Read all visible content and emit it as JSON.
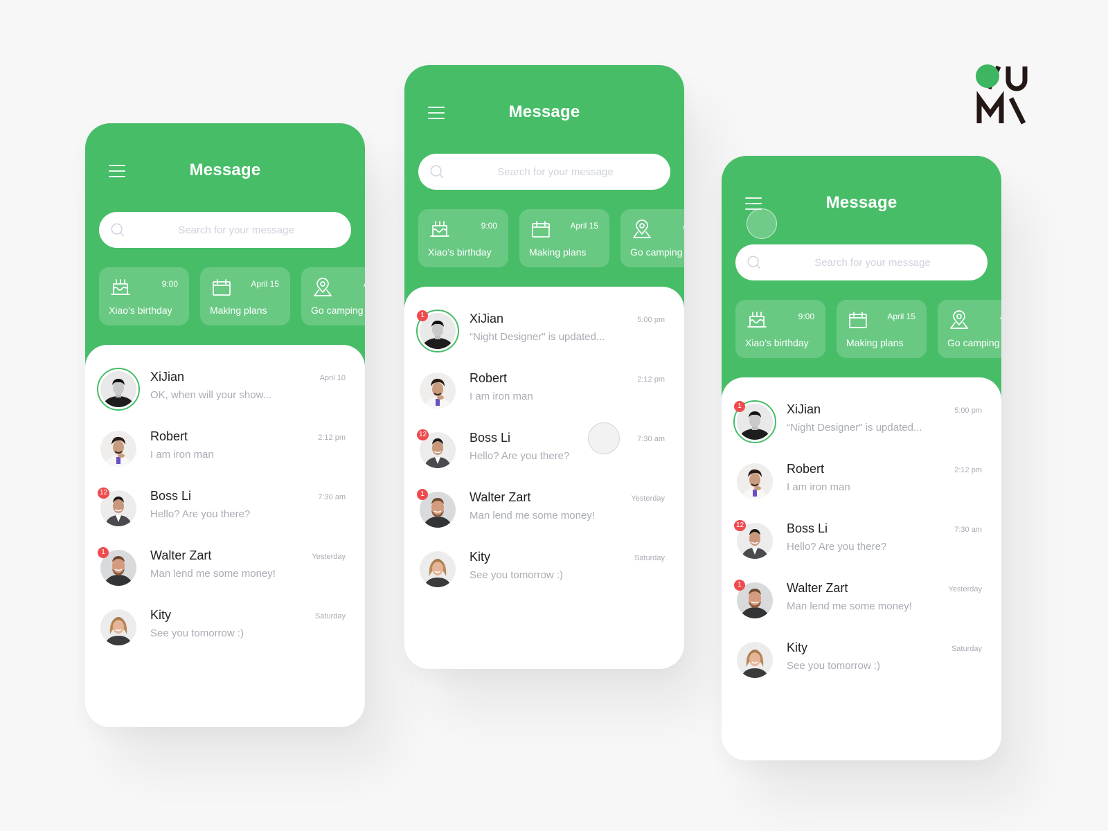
{
  "brand": {
    "logo_line1": "YU",
    "logo_line2": "MW",
    "accent_color": "#48bd68",
    "badge_color": "#ee4b4f"
  },
  "screens": [
    {
      "title": "Message",
      "search": {
        "placeholder": "Search for your message",
        "value": ""
      },
      "events": [
        {
          "icon": "birthday-cake-icon",
          "time": "9:00",
          "label": "Xiao’s birthday"
        },
        {
          "icon": "calendar-icon",
          "time": "April 15",
          "label": "Making plans"
        },
        {
          "icon": "location-pin-icon",
          "time": "April",
          "label": "Go camping"
        }
      ],
      "chats": [
        {
          "name": "XiJian",
          "preview": "OK,  when will your show...",
          "time": "April 10",
          "badge": "",
          "highlighted": true
        },
        {
          "name": "Robert",
          "preview": "I am iron man",
          "time": "2:12 pm",
          "badge": ""
        },
        {
          "name": "Boss Li",
          "preview": "Hello? Are you there?",
          "time": "7:30 am",
          "badge": "12"
        },
        {
          "name": "Walter Zart",
          "preview": "Man lend me some money!",
          "time": "Yesterday",
          "badge": "1"
        },
        {
          "name": "Kity",
          "preview": "See you tomorrow :)",
          "time": "Saturday",
          "badge": ""
        }
      ]
    },
    {
      "title": "Message",
      "search": {
        "placeholder": "Search for your message",
        "value": ""
      },
      "events": [
        {
          "icon": "birthday-cake-icon",
          "time": "9:00",
          "label": "Xiao’s birthday"
        },
        {
          "icon": "calendar-icon",
          "time": "April 15",
          "label": "Making plans"
        },
        {
          "icon": "location-pin-icon",
          "time": "April",
          "label": "Go camping"
        }
      ],
      "chats": [
        {
          "name": "XiJian",
          "preview": "“Night Designer\" is updated...",
          "time": "5:00 pm",
          "badge": "1",
          "highlighted": true
        },
        {
          "name": "Robert",
          "preview": "I am iron man",
          "time": "2:12 pm",
          "badge": ""
        },
        {
          "name": "Boss Li",
          "preview": "Hello? Are you there?",
          "time": "7:30 am",
          "badge": "12"
        },
        {
          "name": "Walter Zart",
          "preview": "Man lend me some money!",
          "time": "Yesterday",
          "badge": "1"
        },
        {
          "name": "Kity",
          "preview": "See you tomorrow :)",
          "time": "Saturday",
          "badge": ""
        }
      ]
    },
    {
      "title": "Message",
      "search": {
        "placeholder": "Search for your message",
        "value": ""
      },
      "events": [
        {
          "icon": "birthday-cake-icon",
          "time": "9:00",
          "label": "Xiao’s birthday"
        },
        {
          "icon": "calendar-icon",
          "time": "April 15",
          "label": "Making plans"
        },
        {
          "icon": "location-pin-icon",
          "time": "April",
          "label": "Go camping"
        }
      ],
      "chats": [
        {
          "name": "XiJian",
          "preview": "“Night Designer\" is updated...",
          "time": "5:00 pm",
          "badge": "1",
          "highlighted": true
        },
        {
          "name": "Robert",
          "preview": "I am iron man",
          "time": "2:12 pm",
          "badge": ""
        },
        {
          "name": "Boss Li",
          "preview": "Hello? Are you there?",
          "time": "7:30 am",
          "badge": "12"
        },
        {
          "name": "Walter Zart",
          "preview": "Man lend me some money!",
          "time": "Yesterday",
          "badge": "1"
        },
        {
          "name": "Kity",
          "preview": "See you tomorrow :)",
          "time": "Saturday",
          "badge": ""
        }
      ]
    }
  ]
}
